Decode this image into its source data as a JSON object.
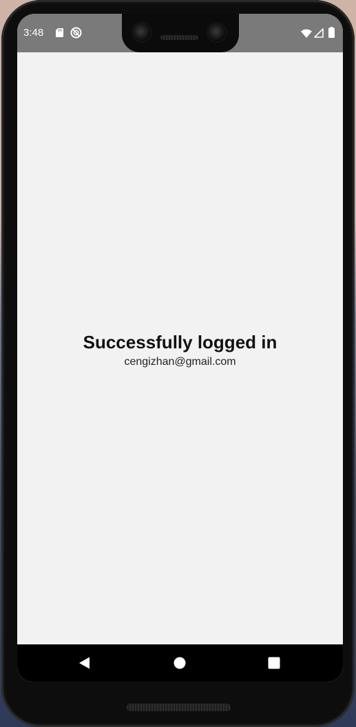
{
  "status_bar": {
    "time": "3:48",
    "left_icons": [
      "sd-card-icon",
      "sync-blocked-icon"
    ],
    "right_icons": [
      "wifi-icon",
      "cell-signal-icon",
      "battery-icon"
    ],
    "background_color": "#7a7a7a"
  },
  "main": {
    "title": "Successfully logged in",
    "email": "cengizhan@gmail.com",
    "background_color": "#f2f2f2"
  },
  "navigation_bar": {
    "buttons": [
      "back-icon",
      "home-icon",
      "recents-icon"
    ],
    "background_color": "#000000"
  }
}
